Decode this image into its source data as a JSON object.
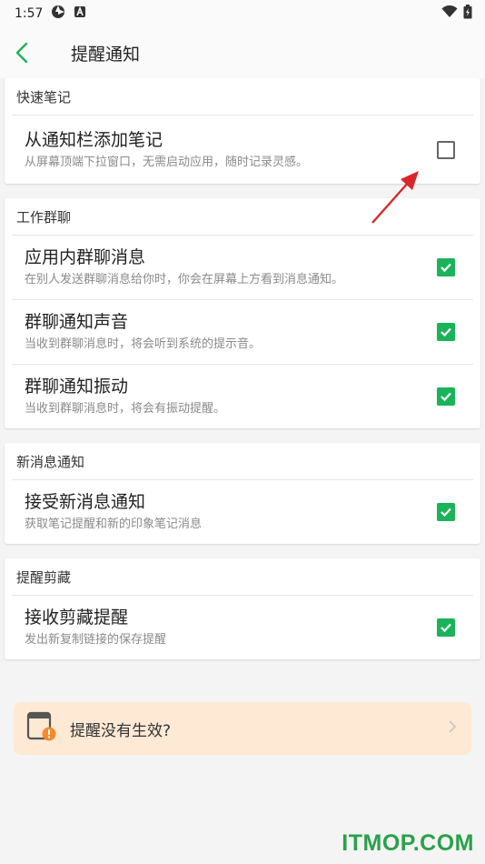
{
  "status_bar": {
    "time": "1:57"
  },
  "app_bar": {
    "title": "提醒通知"
  },
  "sections": [
    {
      "header": "快速笔记",
      "items": [
        {
          "title": "从通知栏添加笔记",
          "subtitle": "从屏幕顶端下拉窗口，无需启动应用，随时记录灵感。",
          "checked": false
        }
      ]
    },
    {
      "header": "工作群聊",
      "items": [
        {
          "title": "应用内群聊消息",
          "subtitle": "在别人发送群聊消息给你时，你会在屏幕上方看到消息通知。",
          "checked": true
        },
        {
          "title": "群聊通知声音",
          "subtitle": "当收到群聊消息时，将会听到系统的提示音。",
          "checked": true
        },
        {
          "title": "群聊通知振动",
          "subtitle": "当收到群聊消息时，将会有振动提醒。",
          "checked": true
        }
      ]
    },
    {
      "header": "新消息通知",
      "items": [
        {
          "title": "接受新消息通知",
          "subtitle": "获取笔记提醒和新的印象笔记消息",
          "checked": true
        }
      ]
    },
    {
      "header": "提醒剪藏",
      "items": [
        {
          "title": "接收剪藏提醒",
          "subtitle": "发出新复制链接的保存提醒",
          "checked": true
        }
      ]
    }
  ],
  "help": {
    "label": "提醒没有生效?"
  },
  "watermark": "ITMOP.COM",
  "colors": {
    "accent": "#1bb35a",
    "help_bg": "#fde9d4",
    "warning": "#f5892b",
    "annotation_arrow": "#d9262c"
  }
}
